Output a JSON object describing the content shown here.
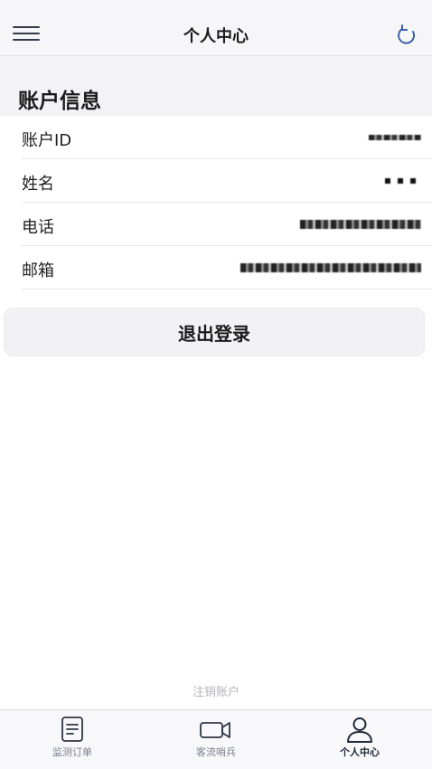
{
  "header": {
    "title": "个人中心",
    "menu_icon": "menu-icon",
    "refresh_icon": "refresh-icon"
  },
  "account": {
    "section_title": "账户信息",
    "rows": [
      {
        "label": "账户ID"
      },
      {
        "label": "姓名"
      },
      {
        "label": "电话"
      },
      {
        "label": "邮箱"
      }
    ]
  },
  "logout": {
    "label": "退出登录"
  },
  "cancel_account": {
    "label": "注销账户"
  },
  "tabbar": {
    "tabs": [
      {
        "label": "监测订单",
        "icon": "document-icon",
        "active": false
      },
      {
        "label": "客流哨兵",
        "icon": "video-camera-icon",
        "active": false
      },
      {
        "label": "个人中心",
        "icon": "person-icon",
        "active": true
      }
    ]
  },
  "colors": {
    "accent": "#3b5fa8",
    "icon_dark": "#2f3645",
    "background": "#f3f3f5"
  }
}
